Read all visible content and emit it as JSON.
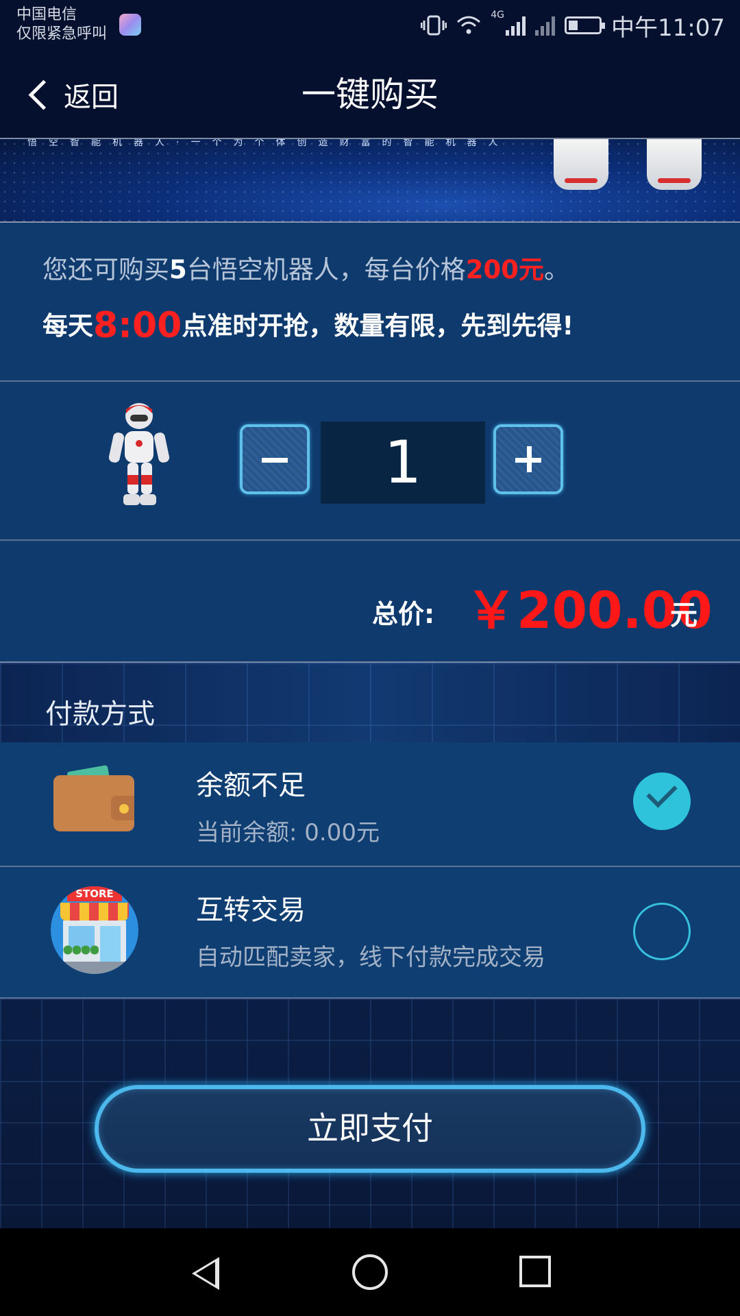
{
  "status_bar": {
    "carrier_line1": "中国电信",
    "carrier_line2": "仅限紧急呼叫",
    "network": "4G",
    "time": "中午11:07",
    "battery_level": 0.3
  },
  "header": {
    "back_label": "返回",
    "title": "一键购买"
  },
  "banner": {
    "text": "悟空智能机器人·一个为个体创造财富的智能机器人"
  },
  "info": {
    "line1_prefix": "您还可购买",
    "line1_count": "5",
    "line1_mid": "台悟空机器人，每台价格",
    "line1_price": "200元",
    "line1_suffix": "。",
    "line2_prefix": "每天",
    "line2_time": "8:00",
    "line2_suffix": "点准时开抢，数量有限，先到先得!"
  },
  "quantity": {
    "value": "1"
  },
  "total": {
    "label": "总价:",
    "value": "￥200.00",
    "unit": "元"
  },
  "payment": {
    "section_title": "付款方式",
    "options": [
      {
        "title": "余额不足",
        "subtitle": "当前余额: 0.00元",
        "icon": "wallet-icon",
        "selected": true
      },
      {
        "title": "互转交易",
        "subtitle": "自动匹配卖家，线下付款完成交易",
        "icon": "store-icon",
        "selected": false
      }
    ],
    "store_sign": "STORE"
  },
  "actions": {
    "pay_label": "立即支付"
  },
  "colors": {
    "accent_red": "#ff2020",
    "panel_blue": "#0f3a6e",
    "check_cyan": "#2fc3db",
    "button_border": "#4db8ec"
  }
}
